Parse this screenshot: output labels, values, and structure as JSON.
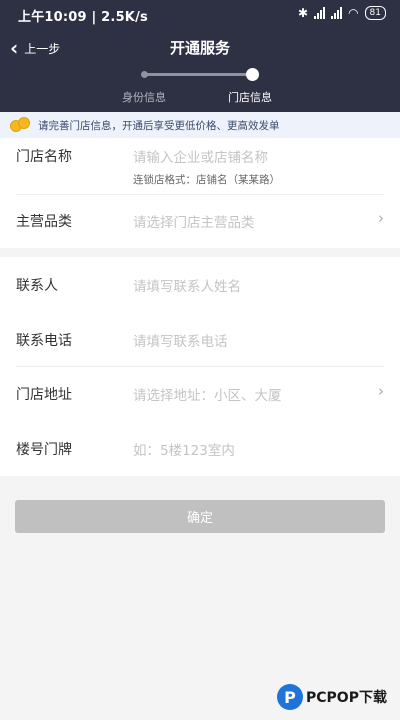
{
  "status": {
    "text": "上午10:09 | 2.5K/s",
    "battery": "81"
  },
  "header": {
    "back_label": "上一步",
    "title": "开通服务",
    "steps": [
      {
        "label": "身份信息"
      },
      {
        "label": "门店信息"
      }
    ],
    "active_step": 2
  },
  "notice": {
    "text": "请完善门店信息，开通后享受更低价格、更高效发单"
  },
  "form": {
    "store_name": {
      "label": "门店名称",
      "placeholder": "请输入企业或店铺名称",
      "hint": "连锁店格式：店铺名（某某路）"
    },
    "category": {
      "label": "主营品类",
      "placeholder": "请选择门店主营品类"
    },
    "contact": {
      "label": "联系人",
      "placeholder": "请填写联系人姓名"
    },
    "phone": {
      "label": "联系电话",
      "placeholder": "请填写联系电话"
    },
    "address": {
      "label": "门店地址",
      "placeholder": "请选择地址：小区、大厦"
    },
    "house_no": {
      "label": "楼号门牌",
      "placeholder": "如：5楼123室内"
    }
  },
  "confirm_label": "确定",
  "watermark": {
    "logo": "P",
    "text": "PCPOP下载"
  },
  "colors": {
    "header_bg": "#2e3044",
    "notice_bg": "#eef3fb",
    "button_disabled": "#c0c0c0"
  }
}
